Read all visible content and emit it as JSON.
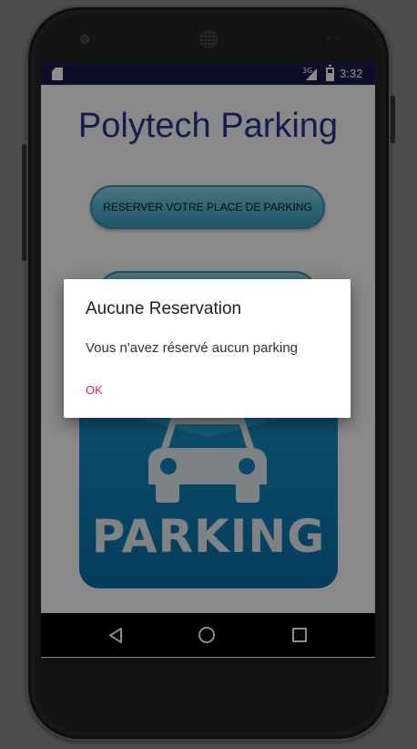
{
  "status_bar": {
    "network": "3G",
    "time": "3:32"
  },
  "app": {
    "title": "Polytech Parking",
    "reserve_button_label": "RESERVER VOTRE PLACE DE PARKING",
    "parking_sign_text": "PARKING"
  },
  "dialog": {
    "title": "Aucune Reservation",
    "message": "Vous n'avez réservé aucun parking",
    "ok_label": "OK",
    "ok_color": "#e91e63"
  },
  "colors": {
    "status_bar": "#1a1b4b",
    "title": "#2b3490",
    "button": "#56b7d6",
    "parking_sign": "#0a6fa8"
  },
  "icons": {
    "status_left": "sd-card-icon",
    "signal": "signal-icon",
    "battery": "battery-icon",
    "nav_back": "back-icon",
    "nav_home": "home-icon",
    "nav_recent": "recent-apps-icon",
    "parking_car": "car-icon"
  }
}
